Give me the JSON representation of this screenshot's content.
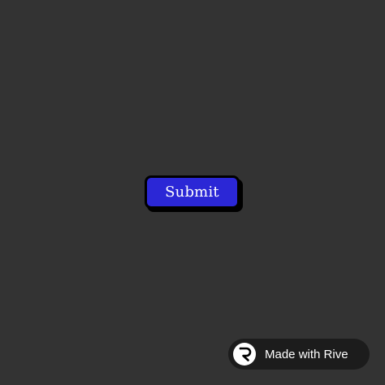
{
  "colors": {
    "background": "#333333",
    "button_fill": "#2b27d6",
    "button_border": "#000000",
    "button_text": "#ffffff",
    "badge_bg": "#1c1c1c",
    "badge_text": "#ffffff"
  },
  "main": {
    "submit_label": "Submit"
  },
  "badge": {
    "label": "Made with Rive",
    "logo_icon": "rive-logo-icon"
  }
}
